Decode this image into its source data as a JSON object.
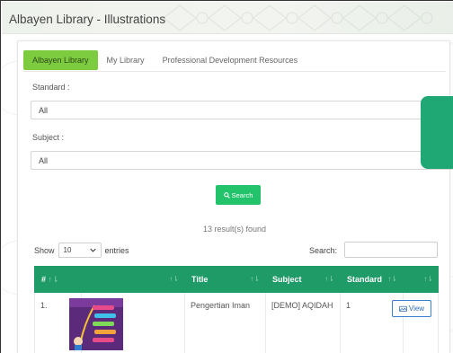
{
  "window": {
    "title": "Albayen Library - Illustrations"
  },
  "tabs": [
    {
      "label": "Albayen Library",
      "active": true
    },
    {
      "label": "My Library",
      "active": false
    },
    {
      "label": "Professional Development Resources",
      "active": false
    }
  ],
  "filters": {
    "standard": {
      "label": "Standard :",
      "value": "All"
    },
    "subject": {
      "label": "Subject :",
      "value": "All"
    }
  },
  "search_button": {
    "label": "Search",
    "icon": "search-icon"
  },
  "results": {
    "text": "13 result(s) found"
  },
  "table_controls": {
    "show_label": "Show",
    "page_length": "10",
    "entries_label": "entries",
    "search_label": "Search:",
    "search_value": ""
  },
  "table": {
    "columns": [
      "#",
      "",
      "Title",
      "Subject",
      "Standard",
      ""
    ],
    "rows": [
      {
        "num": "1.",
        "title": "Pengertian Iman",
        "subject": "[DEMO] AQIDAH",
        "standard": "1",
        "action": "View"
      }
    ]
  },
  "colors": {
    "accent_green": "#22c36b",
    "table_header": "#1f9b68",
    "active_tab": "#7dcb3f",
    "popup": "#1fa774",
    "view_button": "#3b7fcf"
  }
}
